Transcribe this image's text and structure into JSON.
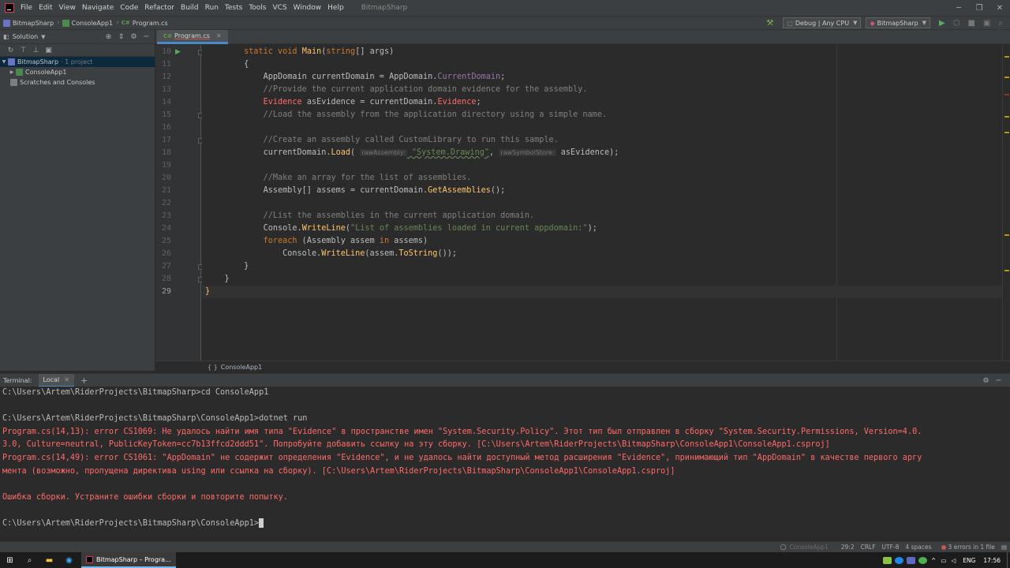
{
  "menu": {
    "items": [
      "File",
      "Edit",
      "View",
      "Navigate",
      "Code",
      "Refactor",
      "Build",
      "Run",
      "Tests",
      "Tools",
      "VCS",
      "Window",
      "Help"
    ],
    "project_title": "BitmapSharp"
  },
  "navbar": {
    "crumbs": [
      "BitmapSharp",
      "ConsoleApp1",
      "Program.cs"
    ],
    "config": "Debug | Any CPU",
    "run_target": "BitmapSharp"
  },
  "solution_panel": {
    "title": "Solution",
    "tree": [
      {
        "label": "BitmapSharp",
        "note": "· 1 project"
      },
      {
        "label": "ConsoleApp1",
        "note": ""
      },
      {
        "label": "Scratches and Consoles",
        "note": ""
      }
    ]
  },
  "editor": {
    "tab": {
      "lang": "C#",
      "name": "Program.cs"
    },
    "current_line": "29",
    "breadcrumb": "ConsoleApp1",
    "lines": [
      {
        "num": "10",
        "indent": "        ",
        "parts": [
          [
            "kw",
            "static "
          ],
          [
            "kw",
            "void "
          ],
          [
            "fn",
            "Main"
          ],
          [
            "p",
            "("
          ],
          [
            "kw",
            "string"
          ],
          [
            "p",
            "[] "
          ],
          [
            "p",
            "args"
          ],
          [
            "p",
            ")"
          ]
        ]
      },
      {
        "num": "11",
        "indent": "        ",
        "parts": [
          [
            "p",
            "{"
          ]
        ]
      },
      {
        "num": "12",
        "indent": "            ",
        "parts": [
          [
            "p",
            "AppDomain currentDomain = AppDomain."
          ],
          [
            "prop",
            "CurrentDomain"
          ],
          [
            "p",
            ";"
          ]
        ]
      },
      {
        "num": "13",
        "indent": "            ",
        "parts": [
          [
            "cm",
            "//Provide the current application domain evidence for the assembly."
          ]
        ]
      },
      {
        "num": "14",
        "indent": "            ",
        "parts": [
          [
            "err",
            "Evidence"
          ],
          [
            "p",
            " asEvidence = currentDomain."
          ],
          [
            "err",
            "Evidence"
          ],
          [
            "p",
            ";"
          ]
        ]
      },
      {
        "num": "15",
        "indent": "            ",
        "parts": [
          [
            "cm",
            "//Load the assembly from the application directory using a simple name."
          ]
        ]
      },
      {
        "num": "16",
        "indent": "",
        "parts": []
      },
      {
        "num": "17",
        "indent": "            ",
        "parts": [
          [
            "cm",
            "//Create an assembly called CustomLibrary to run this sample."
          ]
        ]
      },
      {
        "num": "18",
        "indent": "            ",
        "parts": [
          [
            "p",
            "currentDomain."
          ],
          [
            "fn",
            "Load"
          ],
          [
            "p",
            "( "
          ],
          [
            "param",
            "rawAssembly:"
          ],
          [
            "str",
            " \"System.Drawing\""
          ],
          [
            "p",
            ", "
          ],
          [
            "param",
            "rawSymbolStore:"
          ],
          [
            "p",
            " asEvidence);"
          ]
        ]
      },
      {
        "num": "19",
        "indent": "",
        "parts": []
      },
      {
        "num": "20",
        "indent": "            ",
        "parts": [
          [
            "cm",
            "//Make an array for the list of assemblies."
          ]
        ]
      },
      {
        "num": "21",
        "indent": "            ",
        "parts": [
          [
            "p",
            "Assembly[] "
          ],
          [
            "p",
            "assems"
          ],
          [
            "p",
            " = currentDomain."
          ],
          [
            "fn",
            "GetAssemblies"
          ],
          [
            "p",
            "();"
          ]
        ]
      },
      {
        "num": "22",
        "indent": "",
        "parts": []
      },
      {
        "num": "23",
        "indent": "            ",
        "parts": [
          [
            "cm",
            "//List the assemblies in the current application domain."
          ]
        ]
      },
      {
        "num": "24",
        "indent": "            ",
        "parts": [
          [
            "p",
            "Console."
          ],
          [
            "fn",
            "WriteLine"
          ],
          [
            "p",
            "("
          ],
          [
            "str",
            "\"List of assemblies loaded in current appdomain:\""
          ],
          [
            "p",
            ");"
          ]
        ]
      },
      {
        "num": "25",
        "indent": "            ",
        "parts": [
          [
            "kw",
            "foreach"
          ],
          [
            "p",
            " (Assembly assem "
          ],
          [
            "kw",
            "in"
          ],
          [
            "p",
            " assems)"
          ]
        ]
      },
      {
        "num": "26",
        "indent": "                ",
        "parts": [
          [
            "p",
            "Console."
          ],
          [
            "fn",
            "WriteLine"
          ],
          [
            "p",
            "(assem."
          ],
          [
            "fn",
            "ToString"
          ],
          [
            "p",
            "());"
          ]
        ]
      },
      {
        "num": "27",
        "indent": "        ",
        "parts": [
          [
            "p",
            "}"
          ]
        ]
      },
      {
        "num": "28",
        "indent": "    ",
        "parts": [
          [
            "p",
            "}"
          ]
        ]
      },
      {
        "num": "29",
        "indent": "",
        "parts": [
          [
            "fn",
            "}"
          ]
        ]
      }
    ]
  },
  "terminal": {
    "label": "Terminal:",
    "tab": "Local",
    "lines": [
      {
        "type": "out",
        "text": "C:\\Users\\Artem\\RiderProjects\\BitmapSharp>cd ConsoleApp1"
      },
      {
        "type": "out",
        "text": ""
      },
      {
        "type": "out",
        "text": "C:\\Users\\Artem\\RiderProjects\\BitmapSharp\\ConsoleApp1>dotnet run"
      },
      {
        "type": "err",
        "text": "Program.cs(14,13): error CS1069: Не удалось найти имя типа \"Evidence\" в пространстве имен \"System.Security.Policy\". Этот тип был отправлен в сборку \"System.Security.Permissions, Version=4.0."
      },
      {
        "type": "err",
        "text": "3.0, Culture=neutral, PublicKeyToken=cc7b13ffcd2ddd51\". Попробуйте добавить ссылку на эту сборку. [C:\\Users\\Artem\\RiderProjects\\BitmapSharp\\ConsoleApp1\\ConsoleApp1.csproj]"
      },
      {
        "type": "err",
        "text": "Program.cs(14,49): error CS1061: \"AppDomain\" не содержит определения \"Evidence\", и не удалось найти доступный метод расширения \"Evidence\", принимающий тип \"AppDomain\" в качестве первого аргу"
      },
      {
        "type": "err",
        "text": "мента (возможно, пропущена директива using или ссылка на сборку). [C:\\Users\\Artem\\RiderProjects\\BitmapSharp\\ConsoleApp1\\ConsoleApp1.csproj]"
      },
      {
        "type": "out",
        "text": ""
      },
      {
        "type": "err",
        "text": "Ошибка сборки. Устраните ошибки сборки и повторите попытку."
      },
      {
        "type": "out",
        "text": ""
      },
      {
        "type": "prompt",
        "text": "C:\\Users\\Artem\\RiderProjects\\BitmapSharp\\ConsoleApp1>"
      }
    ]
  },
  "statusbar": {
    "context": "ConsoleApp1",
    "position": "29:2",
    "line_sep": "CRLF",
    "encoding": "UTF-8",
    "indent": "4 spaces",
    "errors": "3 errors in 1 file"
  },
  "taskbar": {
    "app_label": "BitmapSharp – Progra...",
    "lang": "ENG",
    "time": "17:56"
  },
  "colors": {
    "accent": "#4a88c7",
    "error": "#ff6b68",
    "keyword": "#cc7832",
    "function": "#ffc66d",
    "string": "#6a8759",
    "comment": "#808080"
  }
}
